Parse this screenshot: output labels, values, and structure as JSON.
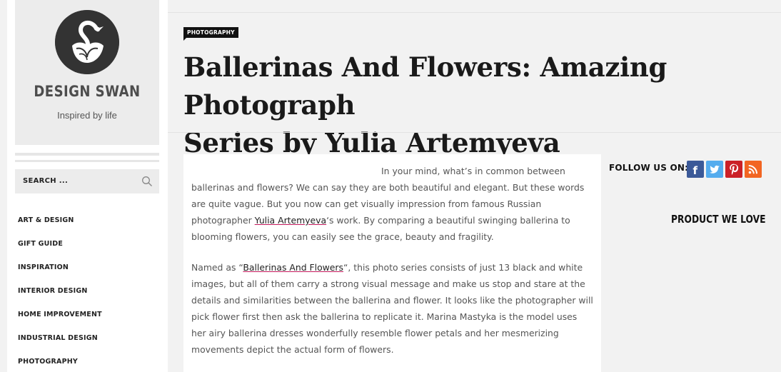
{
  "brand": {
    "name": "DESIGN SWAN",
    "tagline": "Inspired by life"
  },
  "search": {
    "label": "SEARCH ..."
  },
  "nav": {
    "items": [
      {
        "label": "ART & DESIGN"
      },
      {
        "label": "GIFT GUIDE"
      },
      {
        "label": "INSPIRATION"
      },
      {
        "label": "INTERIOR DESIGN"
      },
      {
        "label": "HOME IMPROVEMENT"
      },
      {
        "label": "INDUSTRIAL DESIGN"
      },
      {
        "label": "PHOTOGRAPHY"
      }
    ]
  },
  "post": {
    "category": "PHOTOGRAPHY",
    "title_line1": "Ballerinas And Flowers: Amazing Photograph",
    "title_line2": "Series by Yulia Artemyeva"
  },
  "article": {
    "p1_text1": "In your mind, what’s in common between ballerinas and flowers? We can say they are both beautiful and elegant. But these words are quite vague. But you now can get visually impression from famous Russian photographer ",
    "p1_link": "Yulia Artemyeva",
    "p1_text2": "‘s work. By comparing a beautiful swinging ballerina to blooming flowers, you can easily see the grace, beauty and fragility.",
    "p2_text1": "Named as “",
    "p2_link": "Ballerinas And Flowers",
    "p2_text2": "“, this photo series consists of just 13 black and white images, but all of them carry a strong visual message and make us stop and stare at the details and similarities between the ballerina and flower. It looks like the photographer will pick flower first then ask the ballerina to replicate it. Marina Mastyka is the model uses her airy ballerina dresses wonderfully resemble flower petals and her mesmerizing movements depict the actual form of flowers."
  },
  "social": {
    "follow_label": "FOLLOW US ON:",
    "icons": [
      {
        "name": "facebook-icon",
        "glyph": "f",
        "color": "#3b5998"
      },
      {
        "name": "twitter-icon",
        "glyph": "t",
        "color": "#55acee"
      },
      {
        "name": "pinterest-icon",
        "glyph": "P",
        "color": "#cb2027"
      },
      {
        "name": "rss-icon",
        "glyph": "rss",
        "color": "#f26522"
      }
    ]
  },
  "widgets": {
    "product_heading": "PRODUCT WE LOVE"
  }
}
